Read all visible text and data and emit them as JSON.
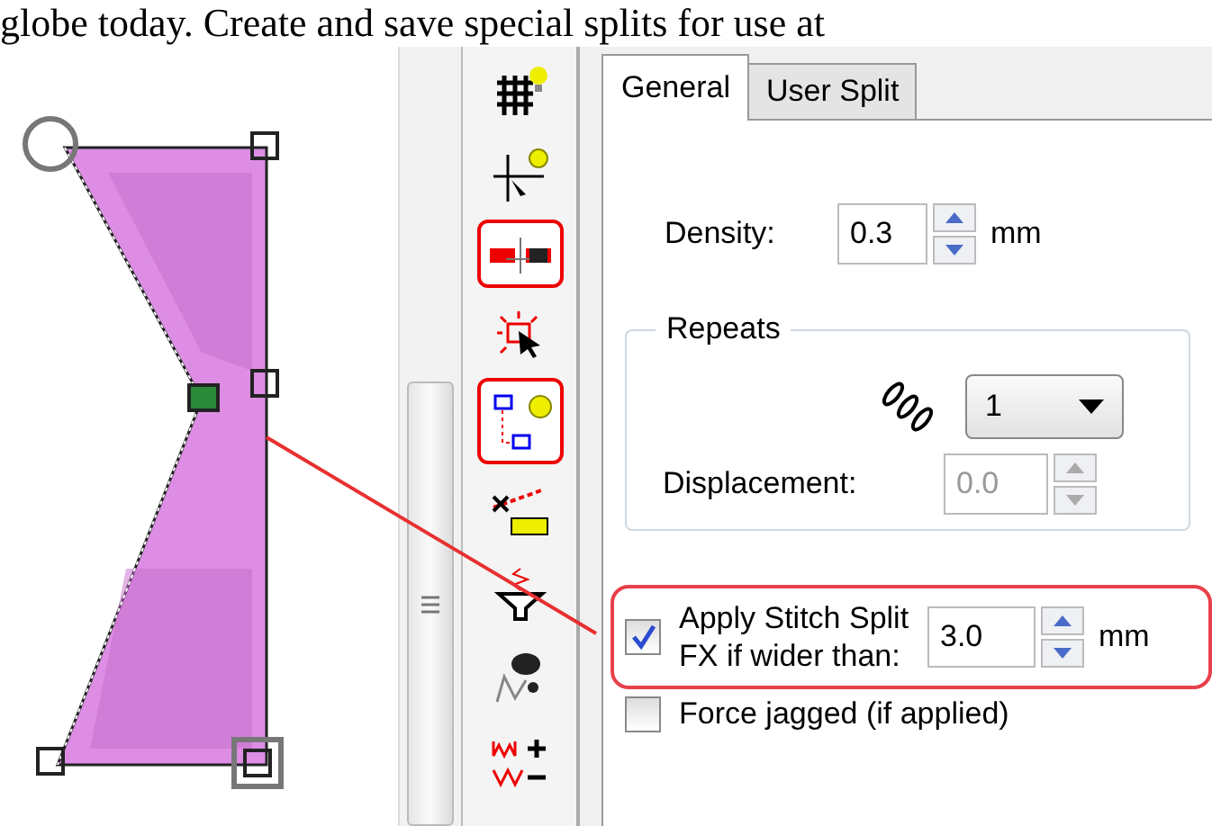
{
  "caption": "globe today. Create and save special splits for use at",
  "toolbar": {
    "items": [
      {
        "kind": "grid-bulb",
        "selected": false
      },
      {
        "kind": "cross-bulb",
        "selected": false
      },
      {
        "kind": "split-line",
        "selected": true
      },
      {
        "kind": "select-spark",
        "selected": false
      },
      {
        "kind": "boxes-bulb",
        "selected": true
      },
      {
        "kind": "measure",
        "selected": false
      },
      {
        "kind": "funnel",
        "selected": false
      },
      {
        "kind": "hand-zigzag",
        "selected": false
      },
      {
        "kind": "plus-minus",
        "selected": false
      }
    ]
  },
  "tabs": [
    {
      "label": "General",
      "selected": true
    },
    {
      "label": "User Split",
      "selected": false
    }
  ],
  "density": {
    "label": "Density:",
    "value": "0.3",
    "unit": "mm"
  },
  "repeats": {
    "title": "Repeats",
    "value": "1",
    "displacement_label": "Displacement:",
    "displacement_value": "0.0",
    "displacement_disabled": true
  },
  "apply_split": {
    "label_lines": [
      "Apply Stitch Split",
      "FX if wider than:"
    ],
    "checked": true,
    "value": "3.0",
    "unit": "mm",
    "highlighted": true
  },
  "force_jagged": {
    "label": "Force jagged (if applied)",
    "checked": false
  }
}
